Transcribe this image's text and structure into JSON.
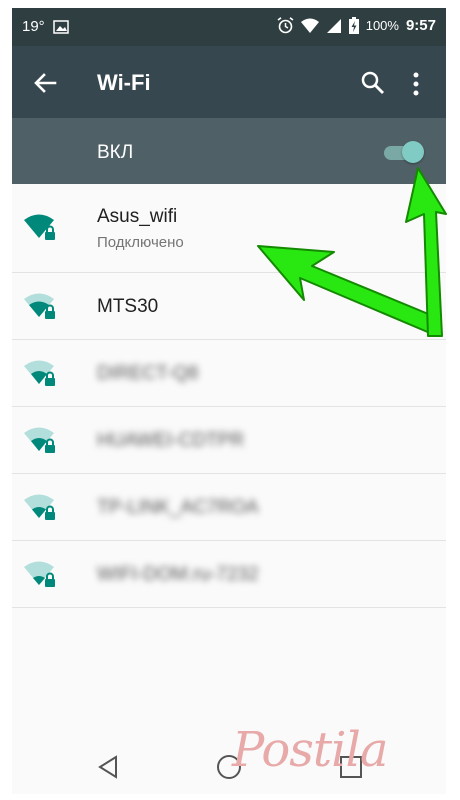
{
  "status_bar": {
    "temperature": "19°",
    "battery": "100%",
    "time": "9:57"
  },
  "app_bar": {
    "title": "Wi-Fi"
  },
  "toggle": {
    "label": "ВКЛ",
    "state": "on"
  },
  "networks": [
    {
      "ssid": "Asus_wifi",
      "status": "Подключено",
      "secured": true
    },
    {
      "ssid": "MTS30",
      "secured": true
    },
    {
      "ssid": "DIRECT-Q8",
      "secured": true,
      "blurred": true
    },
    {
      "ssid": "HUAWEI-CDTPR",
      "secured": true,
      "blurred": true
    },
    {
      "ssid": "TP-LINK_AC7ROA",
      "secured": true,
      "blurred": true
    },
    {
      "ssid": "WIFI-DOM.ru-7232",
      "secured": true,
      "blurred": true
    }
  ],
  "watermark": "Postila",
  "colors": {
    "status_bar": "#2f3e41",
    "app_bar": "#37474f",
    "toggle_bar": "#4f6166",
    "accent": "#009688",
    "arrow": "#22e000"
  },
  "icons": [
    "back-arrow-icon",
    "search-icon",
    "more-vert-icon",
    "wifi-lock-icon",
    "nav-back-icon",
    "nav-home-icon",
    "nav-recents-icon"
  ]
}
